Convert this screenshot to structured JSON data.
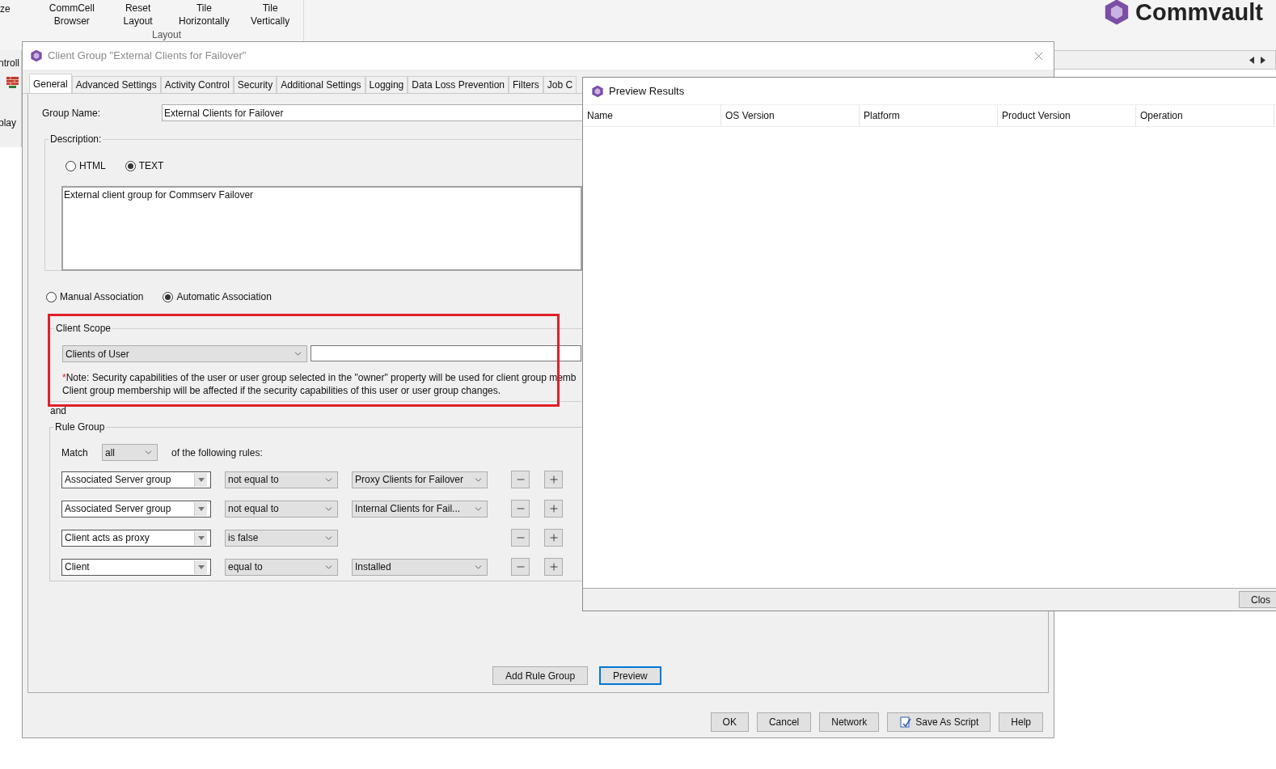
{
  "app": {
    "left_edge_texts": [
      "ze",
      "ntroll",
      "play"
    ],
    "ribbon_buttons": [
      {
        "lines": [
          "CommCell",
          "Browser"
        ]
      },
      {
        "lines": [
          "Reset",
          "Layout"
        ]
      },
      {
        "lines": [
          "Tile",
          "Horizontally"
        ]
      },
      {
        "lines": [
          "Tile",
          "Vertically"
        ]
      }
    ],
    "ribbon_group_label": "Layout",
    "logo_text": "Commvault"
  },
  "dialog": {
    "title": "Client Group \"External Clients for Failover\"",
    "tabs": [
      {
        "label": "General",
        "selected": true
      },
      {
        "label": "Advanced Settings",
        "selected": false
      },
      {
        "label": "Activity Control",
        "selected": false
      },
      {
        "label": "Security",
        "selected": false
      },
      {
        "label": "Additional Settings",
        "selected": false
      },
      {
        "label": "Logging",
        "selected": false
      },
      {
        "label": "Data Loss Prevention",
        "selected": false
      },
      {
        "label": "Filters",
        "selected": false
      },
      {
        "label": "Job C",
        "selected": false
      }
    ],
    "group_name_label": "Group Name:",
    "group_name_value": "External Clients for Failover",
    "description": {
      "legend": "Description:",
      "formats": [
        {
          "label": "HTML",
          "selected": false
        },
        {
          "label": "TEXT",
          "selected": true
        }
      ],
      "text": "External client group for Commserv Failover"
    },
    "association": [
      {
        "label": "Manual Association",
        "selected": false
      },
      {
        "label": "Automatic Association",
        "selected": true
      }
    ],
    "client_scope": {
      "legend": "Client Scope",
      "scope": "Clients of User",
      "note_mark": "*",
      "note_lines": [
        "Note: Security capabilities of the user or user group selected in the \"owner\" property will be used for client group memb",
        "Client group membership will be affected if the security capabilities of this user or user group changes."
      ]
    },
    "and_label": "and",
    "rule_group": {
      "legend": "Rule Group",
      "match_label": "Match",
      "match_value": "all",
      "match_suffix": "of the following rules:",
      "rules": [
        {
          "field": "Associated Server group",
          "operator": "not equal to",
          "value": "Proxy Clients for Failover"
        },
        {
          "field": "Associated Server group",
          "operator": "not equal to",
          "value": "Internal Clients for Fail..."
        },
        {
          "field": "Client acts as proxy",
          "operator": "is false"
        },
        {
          "field": "Client",
          "operator": "equal to",
          "value": "Installed"
        }
      ]
    },
    "rule_buttons": [
      {
        "label": "Add Rule Group",
        "focused": false
      },
      {
        "label": "Preview",
        "focused": true
      }
    ],
    "buttons": [
      {
        "label": "OK",
        "kind": "plain"
      },
      {
        "label": "Cancel",
        "kind": "plain"
      },
      {
        "label": "Network",
        "kind": "plain"
      },
      {
        "label": "Save As Script",
        "kind": "script"
      },
      {
        "label": "Help",
        "kind": "plain"
      }
    ]
  },
  "preview": {
    "title": "Preview Results",
    "columns": [
      "Name",
      "OS Version",
      "Platform",
      "Product Version",
      "Operation"
    ],
    "close_button": "Clos"
  }
}
